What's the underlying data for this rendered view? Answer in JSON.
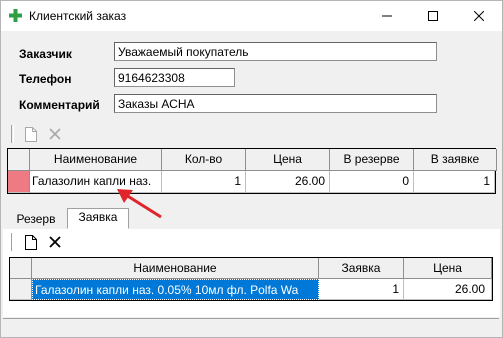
{
  "window": {
    "title": "Клиентский заказ",
    "controls": {
      "minimize": "—",
      "maximize": "☐",
      "close": "✕"
    }
  },
  "form": {
    "customer_label": "Заказчик",
    "customer_value": "Уважаемый покупатель",
    "phone_label": "Телефон",
    "phone_value": "9164623308",
    "comment_label": "Комментарий",
    "comment_value": "Заказы АСНА"
  },
  "top_grid": {
    "columns": [
      "Наименование",
      "Кол-во",
      "Цена",
      "В резерве",
      "В заявке"
    ],
    "rows": [
      {
        "name": "Галазолин капли наз.",
        "qty": "1",
        "price": "26.00",
        "reserved": "0",
        "ordered": "1"
      }
    ]
  },
  "tabs": [
    {
      "label": "Резерв",
      "active": false
    },
    {
      "label": "Заявка",
      "active": true
    }
  ],
  "bottom_grid": {
    "columns": [
      "Наименование",
      "Заявка",
      "Цена"
    ],
    "rows": [
      {
        "name": "Галазолин капли наз. 0.05% 10мл фл. Polfa Wa",
        "order": "1",
        "price": "26.00"
      }
    ]
  },
  "colors": {
    "accent_red": "#e0242b",
    "selection": "#0078d7",
    "row_marker": "#ee7b84",
    "app_icon_green": "#2ea043"
  },
  "icons": {
    "app": "green-cross-icon",
    "new": "new-document-icon",
    "delete": "delete-x-icon",
    "annotation": "red-arrow"
  }
}
